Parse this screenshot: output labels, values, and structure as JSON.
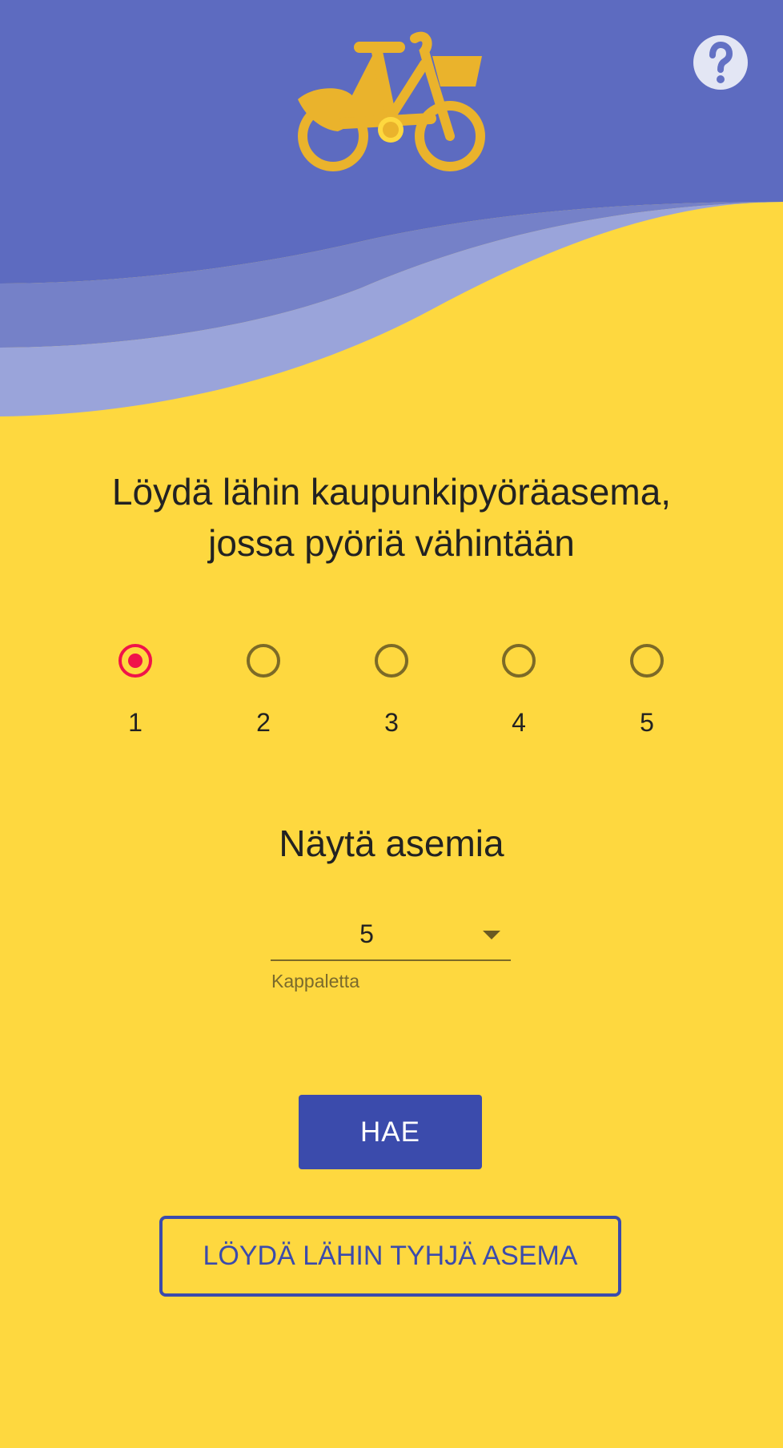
{
  "colors": {
    "background": "#FED83F",
    "header": "#5D6BC0",
    "wave_mid": "#7581C8",
    "wave_light": "#9AA4DA",
    "accent": "#F0134A",
    "primary": "#3B4BAC",
    "logo": "#EAB32C"
  },
  "header": {
    "logo_icon": "bike-icon",
    "help_icon": "question-mark-icon"
  },
  "headline": {
    "line1": "Löydä lähin kaupunkipyöräasema,",
    "line2": "jossa pyöriä vähintään"
  },
  "min_bikes": {
    "selected": "1",
    "options": [
      {
        "label": "1"
      },
      {
        "label": "2"
      },
      {
        "label": "3"
      },
      {
        "label": "4"
      },
      {
        "label": "5"
      }
    ]
  },
  "stations": {
    "title": "Näytä asemia",
    "selected_value": "5",
    "helper": "Kappaletta"
  },
  "actions": {
    "search_label": "HAE",
    "empty_station_label": "LÖYDÄ LÄHIN TYHJÄ ASEMA"
  }
}
